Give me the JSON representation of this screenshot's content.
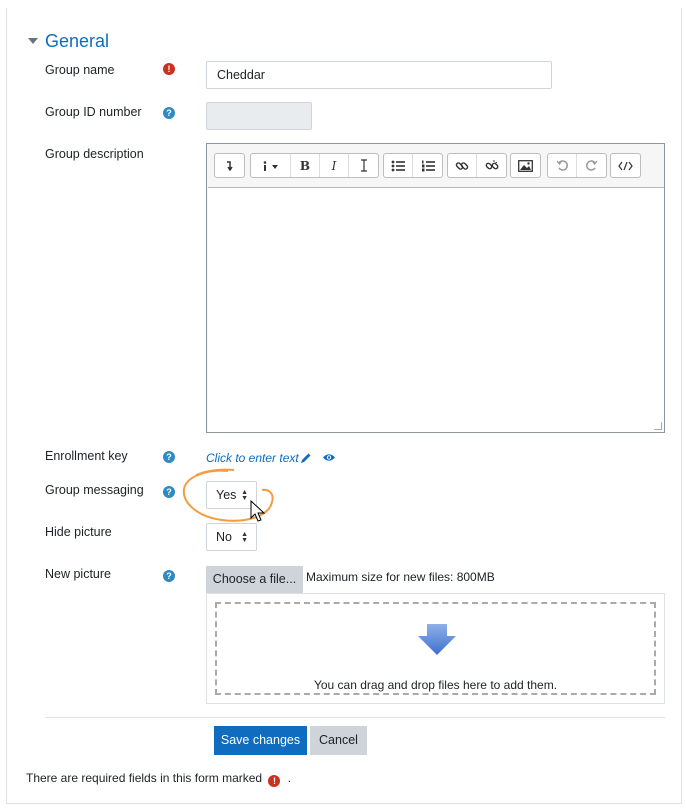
{
  "section": {
    "title": "General"
  },
  "fields": {
    "group_name": {
      "label": "Group name",
      "value": "Cheddar"
    },
    "group_id": {
      "label": "Group ID number",
      "value": ""
    },
    "group_description": {
      "label": "Group description"
    },
    "enrollment_key": {
      "label": "Enrollment key",
      "link_text": "Click to enter text"
    },
    "group_messaging": {
      "label": "Group messaging",
      "selected": "Yes"
    },
    "hide_picture": {
      "label": "Hide picture",
      "selected": "No"
    },
    "new_picture": {
      "label": "New picture",
      "choose_label": "Choose a file...",
      "max_size": "Maximum size for new files: 800MB",
      "drop_text": "You can drag and drop files here to add them."
    }
  },
  "editor_toolbar": {
    "icons": [
      "collapse-icon",
      "info-dropdown-icon",
      "bold-icon",
      "italic-icon",
      "clear-format-icon",
      "bullet-list-icon",
      "numbered-list-icon",
      "link-icon",
      "unlink-icon",
      "image-icon",
      "undo-icon",
      "redo-icon",
      "html-icon"
    ],
    "bold_glyph": "B",
    "italic_glyph": "I"
  },
  "actions": {
    "save_label": "Save changes",
    "cancel_label": "Cancel"
  },
  "footer": {
    "required_note": "There are required fields in this form marked",
    "period": "."
  },
  "colors": {
    "accent": "#0f6cbf",
    "help_icon": "#2f89c2",
    "required_icon": "#ca3120",
    "annotation": "#f39c40"
  }
}
